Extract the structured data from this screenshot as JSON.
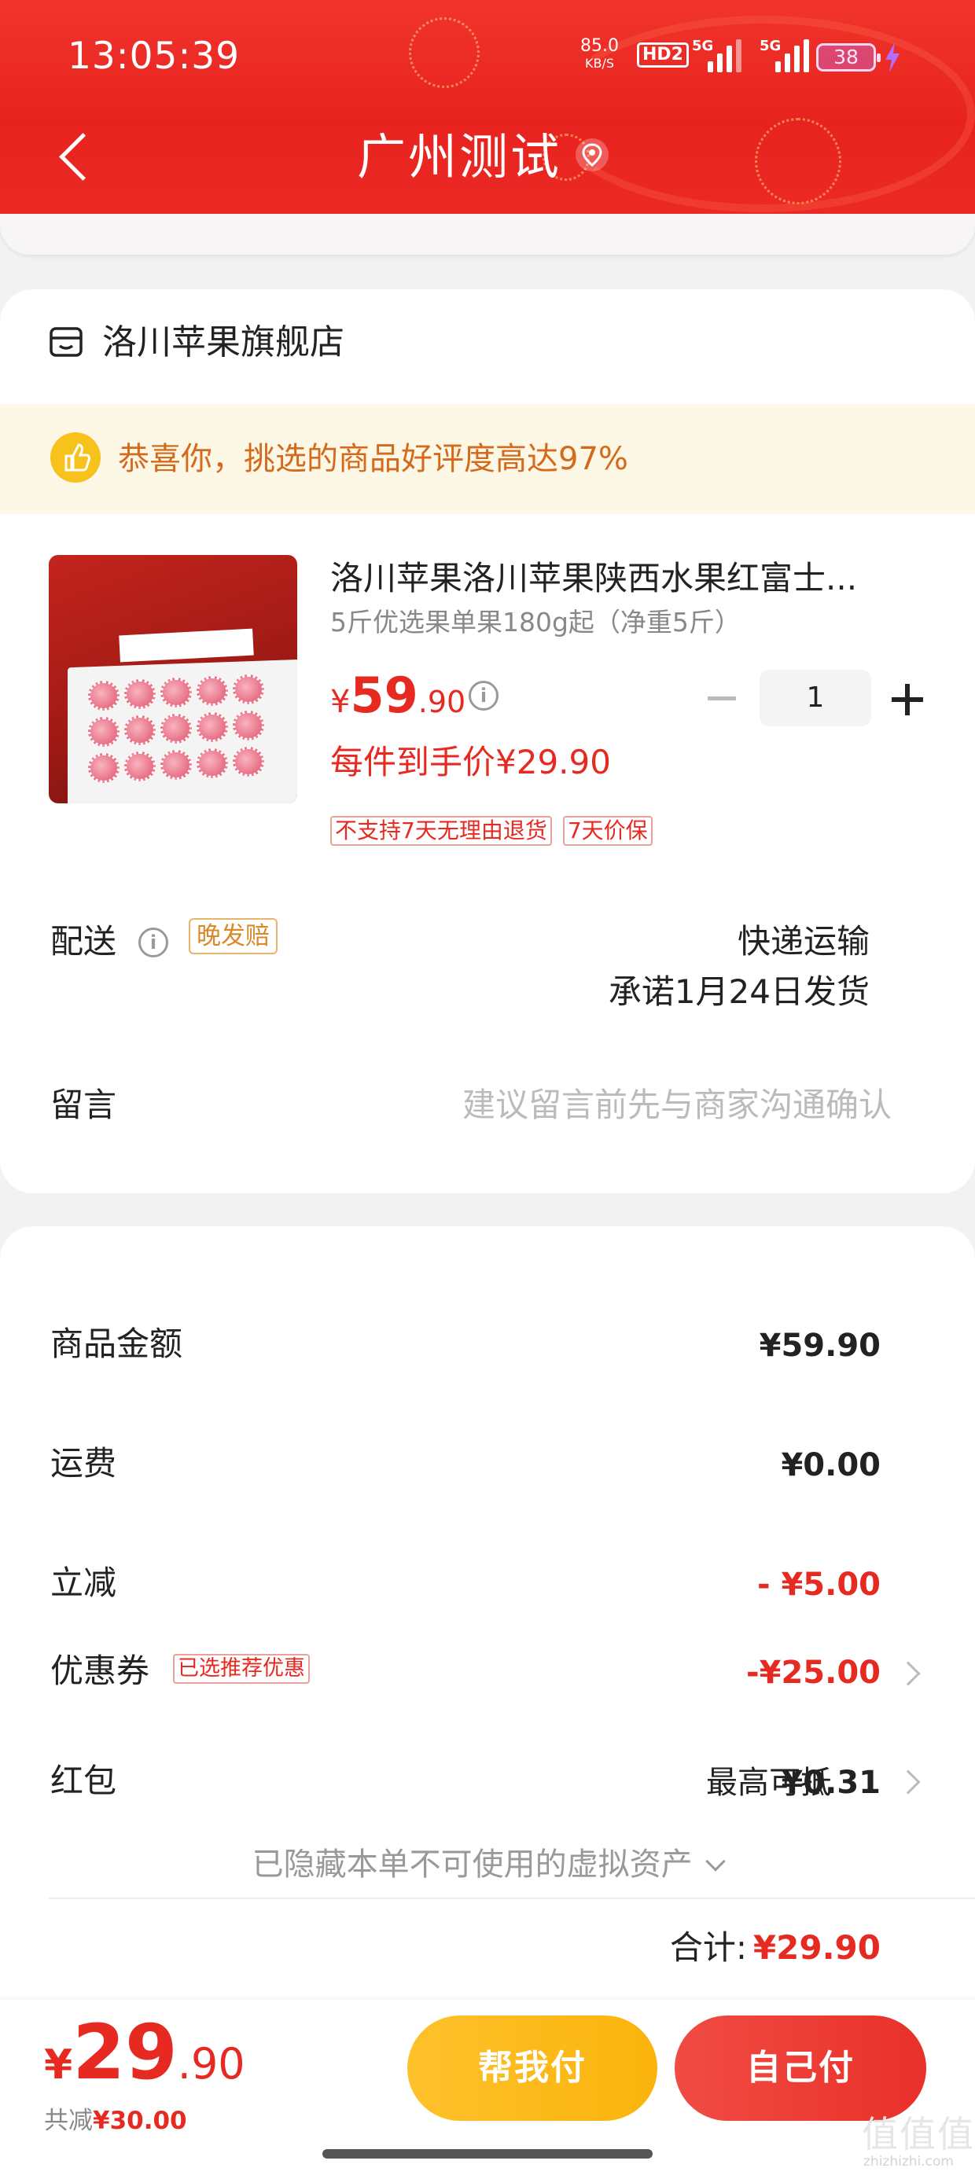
{
  "status_bar": {
    "time": "13:05:39",
    "net_speed": "85.0",
    "net_unit": "KB/S",
    "hd": "HD2",
    "sig1": "5G",
    "sig2": "5G",
    "battery": "38"
  },
  "header": {
    "title": "广州测试",
    "back_icon": "chevron-left-icon",
    "location_icon": "location-pin-icon"
  },
  "store": {
    "name": "洛川苹果旗舰店"
  },
  "banner": {
    "text": "恭喜你，挑选的商品好评度高达97%"
  },
  "product": {
    "title": "洛川苹果洛川苹果陕西水果红富士...",
    "spec": "5斤优选果单果180g起（净重5斤）",
    "price_symbol": "¥",
    "price_int": "59",
    "price_dec": ".90",
    "quantity": "1",
    "hand_price": "每件到手价¥29.90",
    "tags": [
      "不支持7天无理由退货",
      "7天价保"
    ]
  },
  "delivery": {
    "label": "配送",
    "badge": "晚发赔",
    "method": "快递运输",
    "promise": "承诺1月24日发货"
  },
  "message": {
    "label": "留言",
    "placeholder": "建议留言前先与商家沟通确认"
  },
  "fees": {
    "goods_label": "商品金额",
    "goods_value": "¥59.90",
    "shipping_label": "运费",
    "shipping_value": "¥0.00",
    "discount_label": "立减",
    "discount_value": "- ¥5.00",
    "coupon_label": "优惠券",
    "coupon_tag": "已选推荐优惠",
    "coupon_value": "-¥25.00",
    "redpacket_label": "红包",
    "redpacket_hint": "最高可抵",
    "redpacket_value": "¥0.31",
    "hidden_assets": "已隐藏本单不可使用的虚拟资产",
    "total_label": "合计:",
    "total_value": "¥29.90"
  },
  "footer": {
    "price_symbol": "¥",
    "price_int": "29",
    "price_dec": ".90",
    "saved_label": "共减",
    "saved_value": "¥30.00",
    "help_pay": "帮我付",
    "self_pay": "自己付"
  },
  "watermark": {
    "text": "值值值",
    "domain": "zhizhizhi.com"
  },
  "colors": {
    "accent": "#e62a21",
    "header_red": "#ec2a25",
    "help_button": "#fbb40c",
    "banner_bg": "#fdf7e6"
  }
}
